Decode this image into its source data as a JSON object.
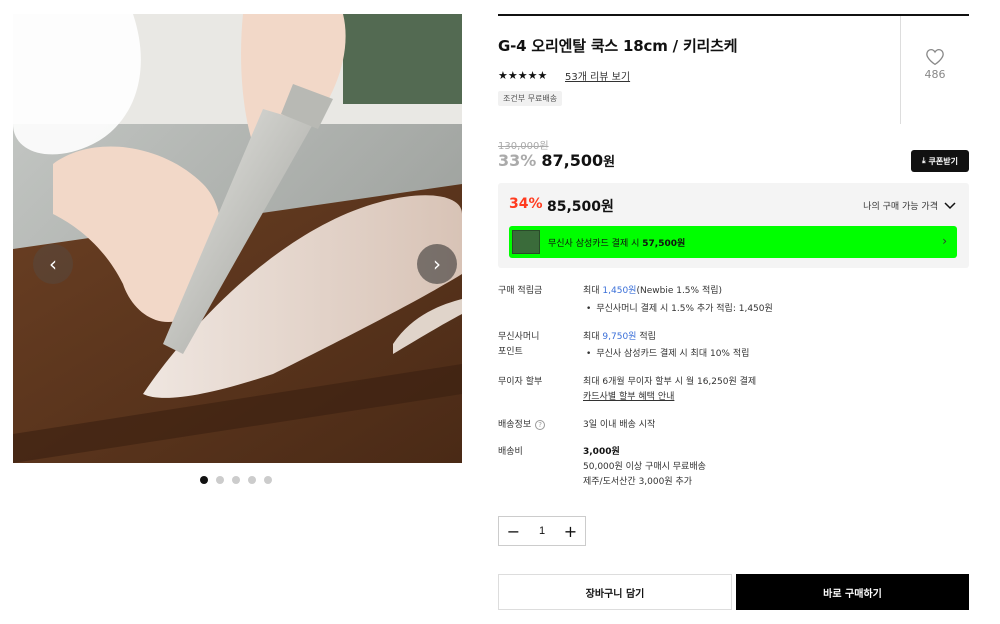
{
  "product": {
    "title": "G-4 오리엔탈 쿡스 18cm / 키리츠케",
    "stars": "★★★★★",
    "review_link": "53개 리뷰 보기",
    "shipping_badge": "조건부 무료배송",
    "likes": "486"
  },
  "gallery": {
    "image_count": 5,
    "active_index": 0,
    "prev_icon": "chevron-left-icon",
    "next_icon": "chevron-right-icon"
  },
  "price": {
    "original": "130,000원",
    "discount_pct": "33%",
    "discounted": "87,500",
    "won": "원",
    "coupon_button": "쿠폰받기"
  },
  "my_price": {
    "pct": "34%",
    "price": "85,500원",
    "label": "나의 구매 가능 가격",
    "card_text": "무신사 삼성카드 결제 시",
    "card_price": "57,500원"
  },
  "info": {
    "points_label": "구매 적립금",
    "points_prefix": "최대 ",
    "points_value": "1,450원",
    "points_suffix": "(Newbie 1.5% 적립)",
    "points_bullet": "무신사머니 결제 시 1.5% 추가 적립: 1,450원",
    "money_label_1": "무신사머니",
    "money_label_2": "포인트",
    "money_prefix": "최대 ",
    "money_value": "9,750원",
    "money_suffix": " 적립",
    "money_bullet": "무신사 삼성카드 결제 시 최대 10% 적립",
    "installment_label": "무이자 할부",
    "installment_text": "최대 6개월 무이자 할부 시 월 16,250원 결제",
    "installment_link": "카드사별 할부 혜택 안내",
    "delivery_label": "배송정보",
    "delivery_text": "3일 이내 배송 시작",
    "fee_label": "배송비",
    "fee_value": "3,000원",
    "fee_line2": "50,000원 이상 구매시 무료배송",
    "fee_line3": "제주/도서산간 3,000원 추가"
  },
  "quantity": {
    "minus": "−",
    "value": "1",
    "plus": "+"
  },
  "actions": {
    "cart": "장바구니 담기",
    "buy": "바로 구매하기"
  },
  "colors": {
    "accent_red": "#ff3b1f",
    "link_blue": "#3a6fd8",
    "banner_green": "#00ff00"
  }
}
